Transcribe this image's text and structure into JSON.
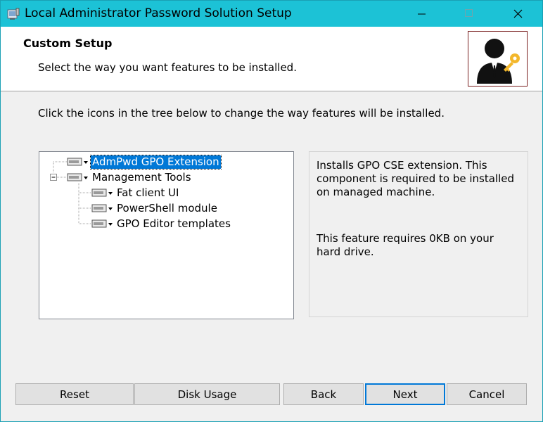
{
  "window": {
    "title": "Local Administrator Password Solution Setup",
    "accent_color": "#1cc2d6",
    "controls": [
      "minimize-icon",
      "maximize-icon",
      "close-icon"
    ]
  },
  "header": {
    "title": "Custom Setup",
    "subtitle": "Select the way you want features to be installed."
  },
  "instruction": "Click the icons in the tree below to change the way features will be installed.",
  "tree": {
    "items": [
      {
        "label": "AdmPwd GPO Extension",
        "selected": true,
        "level": 0
      },
      {
        "label": "Management Tools",
        "selected": false,
        "level": 0,
        "expanded": true
      },
      {
        "label": "Fat client UI",
        "selected": false,
        "level": 1
      },
      {
        "label": "PowerShell module",
        "selected": false,
        "level": 1
      },
      {
        "label": "GPO Editor templates",
        "selected": false,
        "level": 1
      }
    ],
    "selection_color": "#0078d7"
  },
  "description": {
    "text": "Installs GPO CSE extension. This component is required to be installed on managed machine.",
    "size_note": "This feature requires 0KB on your hard drive."
  },
  "buttons": {
    "reset": "Reset",
    "disk_usage": "Disk Usage",
    "back": "Back",
    "next": "Next",
    "cancel": "Cancel"
  }
}
